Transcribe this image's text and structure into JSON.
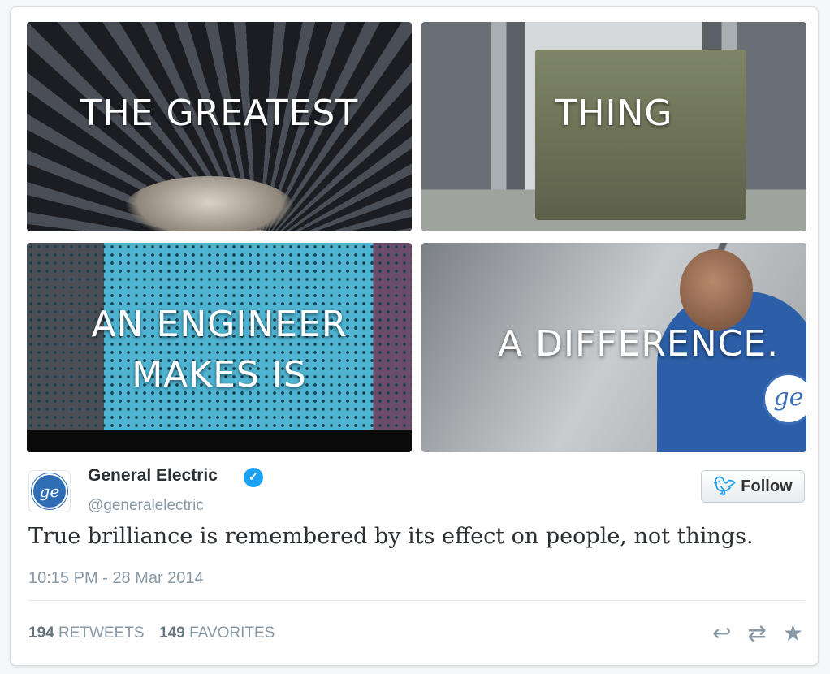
{
  "tiles": [
    {
      "caption_lines": [
        "THE GREATEST"
      ]
    },
    {
      "caption_lines": [
        "THING"
      ]
    },
    {
      "caption_lines": [
        "AN ENGINEER",
        "MAKES IS"
      ]
    },
    {
      "caption_lines": [
        "A DIFFERENCE."
      ]
    }
  ],
  "badge_text": "ge",
  "user": {
    "name": "General Electric",
    "handle": "@generalelectric",
    "avatar_text": "ge",
    "verified_icon": "✓"
  },
  "follow": {
    "icon": "twitter-bird-icon",
    "label": "Follow"
  },
  "tweet": {
    "text": "True brilliance is remembered by its effect on people, not things.",
    "timestamp": "10:15 PM - 28 Mar 2014"
  },
  "stats": {
    "retweets_count": "194",
    "retweets_label": "RETWEETS",
    "favorites_count": "149",
    "favorites_label": "FAVORITES"
  },
  "actions": {
    "reply_icon": "reply-icon",
    "retweet_icon": "retweet-icon",
    "favorite_icon": "star-icon"
  },
  "colors": {
    "accent": "#1da1f2",
    "ge_blue": "#2f6eb5",
    "muted": "#8899a6"
  }
}
